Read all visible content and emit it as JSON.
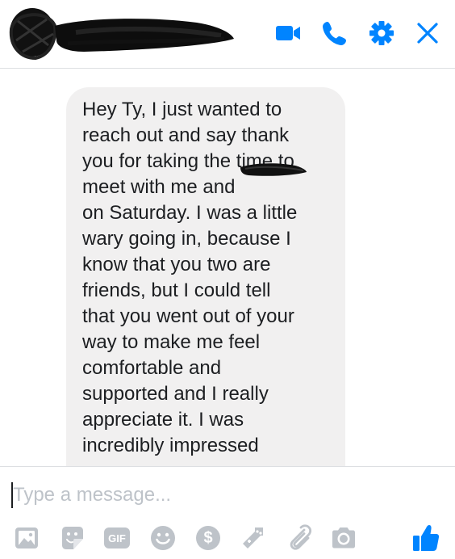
{
  "header": {
    "icons": [
      "video-camera-icon",
      "phone-icon",
      "gear-icon",
      "close-icon"
    ],
    "accent_color": "#0084ff"
  },
  "thread": {
    "message_text": "Hey Ty, I just wanted to\nreach out and say thank\nyou for taking the time to\nmeet with me and\non Saturday. I was a little\nwary going in, because I\nknow that you two are\nfriends, but I could tell\nthat you went out of your\nway to make me feel\ncomfortable and\nsupported and I really\nappreciate it. I was\nincredibly impressed",
    "bubble_color": "#f1f0f0"
  },
  "composer": {
    "placeholder": "Type a message...",
    "tools": [
      "photo-icon",
      "sticker-icon",
      "gif-icon",
      "emoji-icon",
      "payment-icon",
      "game-icon",
      "attachment-icon",
      "camera-icon",
      "thumbs-up-icon"
    ],
    "gif_label": "GIF",
    "payment_label": "$",
    "tool_color": "#bec3c9"
  }
}
